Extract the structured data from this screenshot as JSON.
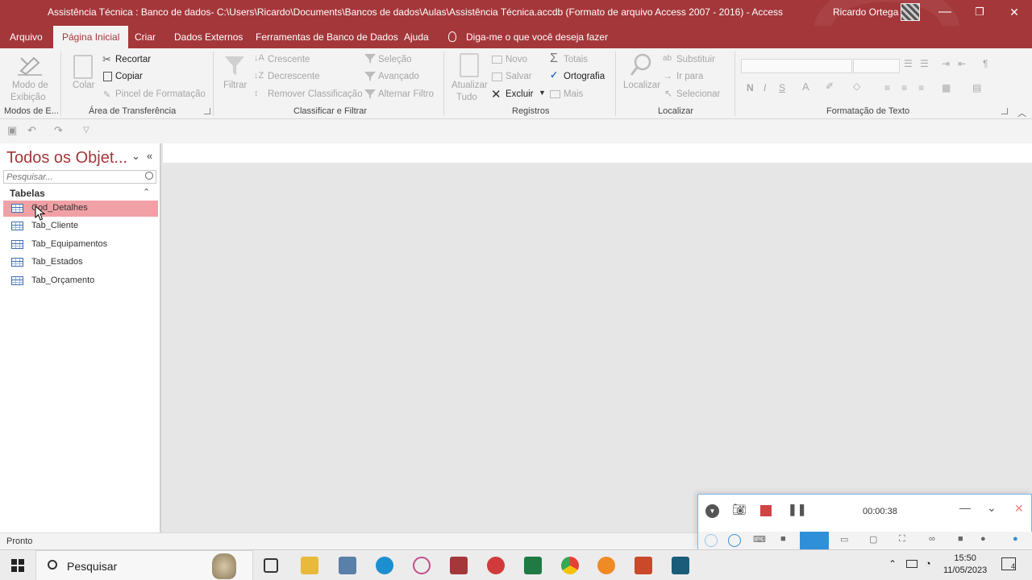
{
  "window": {
    "title": "Assistência Técnica : Banco de dados- C:\\Users\\Ricardo\\Documents\\Bancos de dados\\Aulas\\Assistência Técnica.accdb (Formato de arquivo Access 2007 - 2016)  -  Access",
    "user": "Ricardo Ortega",
    "minimize": "—",
    "restore": "❐",
    "close": "✕",
    "accent_color": "#a4373a"
  },
  "tabs": [
    "Arquivo",
    "Página Inicial",
    "Criar",
    "Dados Externos",
    "Ferramentas de Banco de Dados",
    "Ajuda"
  ],
  "tell_me": "Diga-me o que você deseja fazer",
  "ribbon": {
    "views": {
      "label1": "Modo de",
      "label2": "Exibição",
      "group": "Modos de E..."
    },
    "clipboard": {
      "paste": "Colar",
      "cut": "Recortar",
      "copy": "Copiar",
      "format_painter": "Pincel de Formatação",
      "group": "Área de Transferência"
    },
    "sort_filter": {
      "filter": "Filtrar",
      "ascending": "Crescente",
      "descending": "Decrescente",
      "remove_sort": "Remover Classificação",
      "selection": "Seleção",
      "advanced": "Avançado",
      "toggle_filter": "Alternar Filtro",
      "group": "Classificar e Filtrar"
    },
    "records": {
      "refresh1": "Atualizar",
      "refresh2": "Tudo",
      "new": "Novo",
      "save": "Salvar",
      "delete": "Excluir",
      "totals": "Totais",
      "spelling": "Ortografia",
      "more": "Mais",
      "group": "Registros"
    },
    "find": {
      "find": "Localizar",
      "replace": "Substituir",
      "goto": "Ir para",
      "select": "Selecionar",
      "group": "Localizar"
    },
    "text_format": {
      "bold": "N",
      "italic": "I",
      "underline": "S",
      "group": "Formatação de Texto"
    }
  },
  "nav": {
    "title": "Todos os Objet...",
    "search_placeholder": "Pesquisar...",
    "group": "Tabelas",
    "items": [
      "Cod_Detalhes",
      "Tab_Cliente",
      "Tab_Equipamentos",
      "Tab_Estados",
      "Tab_Orçamento"
    ],
    "selected_index": 0
  },
  "status": "Pronto",
  "recorder": {
    "time": "00:00:38"
  },
  "taskbar": {
    "search": "Pesquisar",
    "time": "15:50",
    "date": "11/05/2023",
    "notifications": "4"
  }
}
